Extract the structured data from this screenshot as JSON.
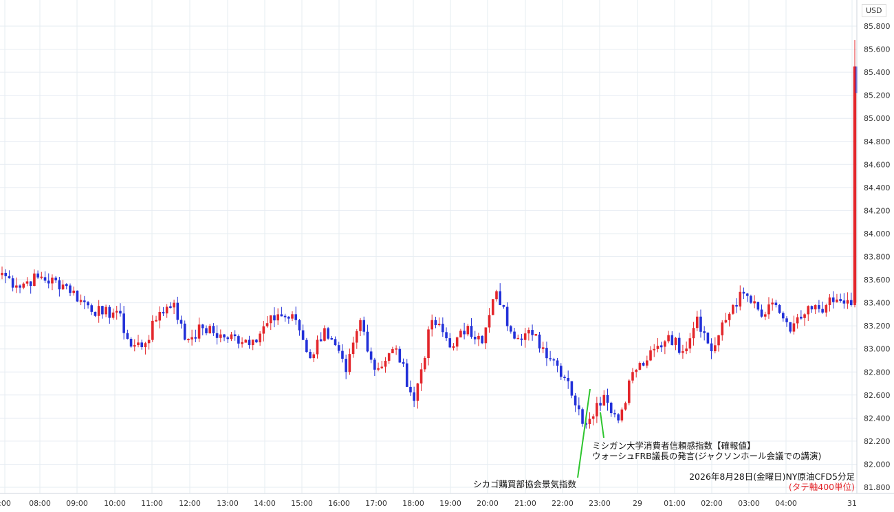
{
  "colors": {
    "up": "#e3262b",
    "down": "#2230d8",
    "grid": "#e6ecf2",
    "annotation_line": "#2ec52e"
  },
  "chart_data": {
    "type": "candlestick",
    "title": "2026年8月28日(金曜日)NY原油CFD5分足",
    "note": "(タテ軸400単位)",
    "currency": "USD",
    "ylim": [
      81.76,
      85.92
    ],
    "y_ticks": [
      "85.800",
      "85.600",
      "85.400",
      "85.200",
      "85.000",
      "84.800",
      "84.600",
      "84.400",
      "84.200",
      "84.000",
      "83.800",
      "83.600",
      "83.400",
      "83.200",
      "83.000",
      "82.800",
      "82.600",
      "82.400",
      "82.200",
      "82.000",
      "81.800"
    ],
    "x_ticks": [
      ":00",
      "08:00",
      "09:00",
      "10:00",
      "11:00",
      "12:00",
      "13:00",
      "14:00",
      "15:00",
      "16:00",
      "17:00",
      "18:00",
      "19:00",
      "20:00",
      "21:00",
      "22:00",
      "23:00",
      "29",
      "01:00",
      "02:00",
      "03:00",
      "04:00",
      "31"
    ],
    "annotations": [
      {
        "id": "chicago_pmi",
        "text": "シカゴ購買部協会景気指数"
      },
      {
        "id": "michigan",
        "text": "ミシガン大学消費者信頼感指数【確報値】"
      },
      {
        "id": "warsh",
        "text": "ウォーシュFRB議長の発言(ジャクソンホール会議での講演)"
      }
    ],
    "anchors": [
      [
        0,
        83.66
      ],
      [
        4,
        83.55
      ],
      [
        10,
        83.62
      ],
      [
        18,
        83.55
      ],
      [
        22,
        83.42
      ],
      [
        28,
        83.3
      ],
      [
        32,
        83.33
      ],
      [
        36,
        83.02
      ],
      [
        40,
        83.05
      ],
      [
        44,
        83.32
      ],
      [
        48,
        83.4
      ],
      [
        51,
        83.08
      ],
      [
        56,
        83.18
      ],
      [
        62,
        83.1
      ],
      [
        70,
        83.08
      ],
      [
        77,
        83.3
      ],
      [
        82,
        83.25
      ],
      [
        86,
        82.92
      ],
      [
        90,
        83.18
      ],
      [
        96,
        82.8
      ],
      [
        100,
        83.25
      ],
      [
        104,
        82.82
      ],
      [
        110,
        83.0
      ],
      [
        115,
        82.55
      ],
      [
        120,
        83.25
      ],
      [
        126,
        83.02
      ],
      [
        130,
        83.2
      ],
      [
        134,
        83.05
      ],
      [
        138,
        83.5
      ],
      [
        142,
        83.15
      ],
      [
        148,
        83.12
      ],
      [
        154,
        82.9
      ],
      [
        158,
        82.72
      ],
      [
        162,
        82.35
      ],
      [
        168,
        82.6
      ],
      [
        172,
        82.38
      ],
      [
        176,
        82.8
      ],
      [
        180,
        82.9
      ],
      [
        186,
        83.12
      ],
      [
        190,
        82.98
      ],
      [
        194,
        83.28
      ],
      [
        198,
        82.98
      ],
      [
        204,
        83.38
      ],
      [
        207,
        83.48
      ],
      [
        212,
        83.28
      ],
      [
        216,
        83.38
      ],
      [
        220,
        83.15
      ],
      [
        224,
        83.3
      ],
      [
        230,
        83.38
      ],
      [
        234,
        83.42
      ],
      [
        237,
        83.38
      ],
      [
        238,
        85.45
      ]
    ]
  }
}
